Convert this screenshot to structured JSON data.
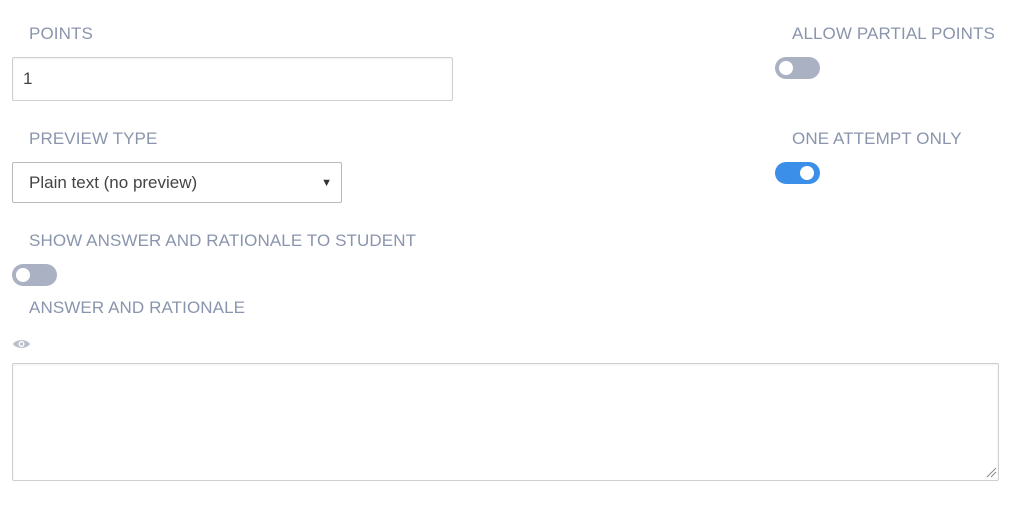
{
  "points": {
    "label": "POINTS",
    "value": "1"
  },
  "allow_partial_points": {
    "label": "ALLOW PARTIAL POINTS",
    "enabled": false
  },
  "preview_type": {
    "label": "PREVIEW TYPE",
    "selected": "Plain text (no preview)"
  },
  "one_attempt_only": {
    "label": "ONE ATTEMPT ONLY",
    "enabled": true
  },
  "show_answer": {
    "label": "SHOW ANSWER AND RATIONALE TO STUDENT",
    "enabled": false
  },
  "answer_rationale": {
    "label": "ANSWER AND RATIONALE",
    "preview_icon": "eye-icon",
    "value": ""
  },
  "colors": {
    "label": "#8a95ad",
    "toggle_off": "#aab1c3",
    "toggle_on": "#3b8fe8"
  }
}
